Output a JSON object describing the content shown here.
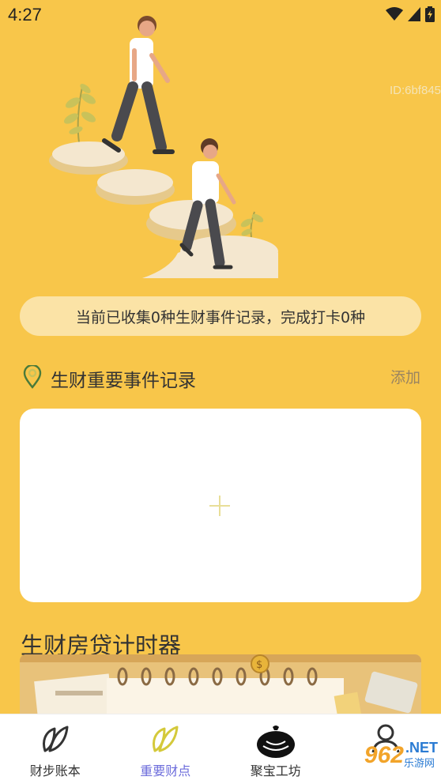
{
  "status_bar": {
    "time": "4:27"
  },
  "hero": {
    "id_text": "ID:6bf845"
  },
  "summary": {
    "text": "当前已收集0种生财事件记录，完成打卡0种"
  },
  "events_section": {
    "title": "生财重要事件记录",
    "add_label": "添加"
  },
  "timer_section": {
    "title": "生财房贷计时器"
  },
  "bottom_nav": {
    "items": [
      {
        "label": "财步账本",
        "icon": "leaf-icon"
      },
      {
        "label": "重要财点",
        "icon": "leaf-icon",
        "active": true
      },
      {
        "label": "聚宝工坊",
        "icon": "money-bag-icon"
      },
      {
        "label": "",
        "icon": "person-icon"
      }
    ]
  },
  "watermark": {
    "brand": "962",
    "suffix": ".NET",
    "site": "乐游网"
  },
  "colors": {
    "background": "#F8C64A",
    "active_nav": "#6B6BDB",
    "pill": "#FBE3A6"
  }
}
